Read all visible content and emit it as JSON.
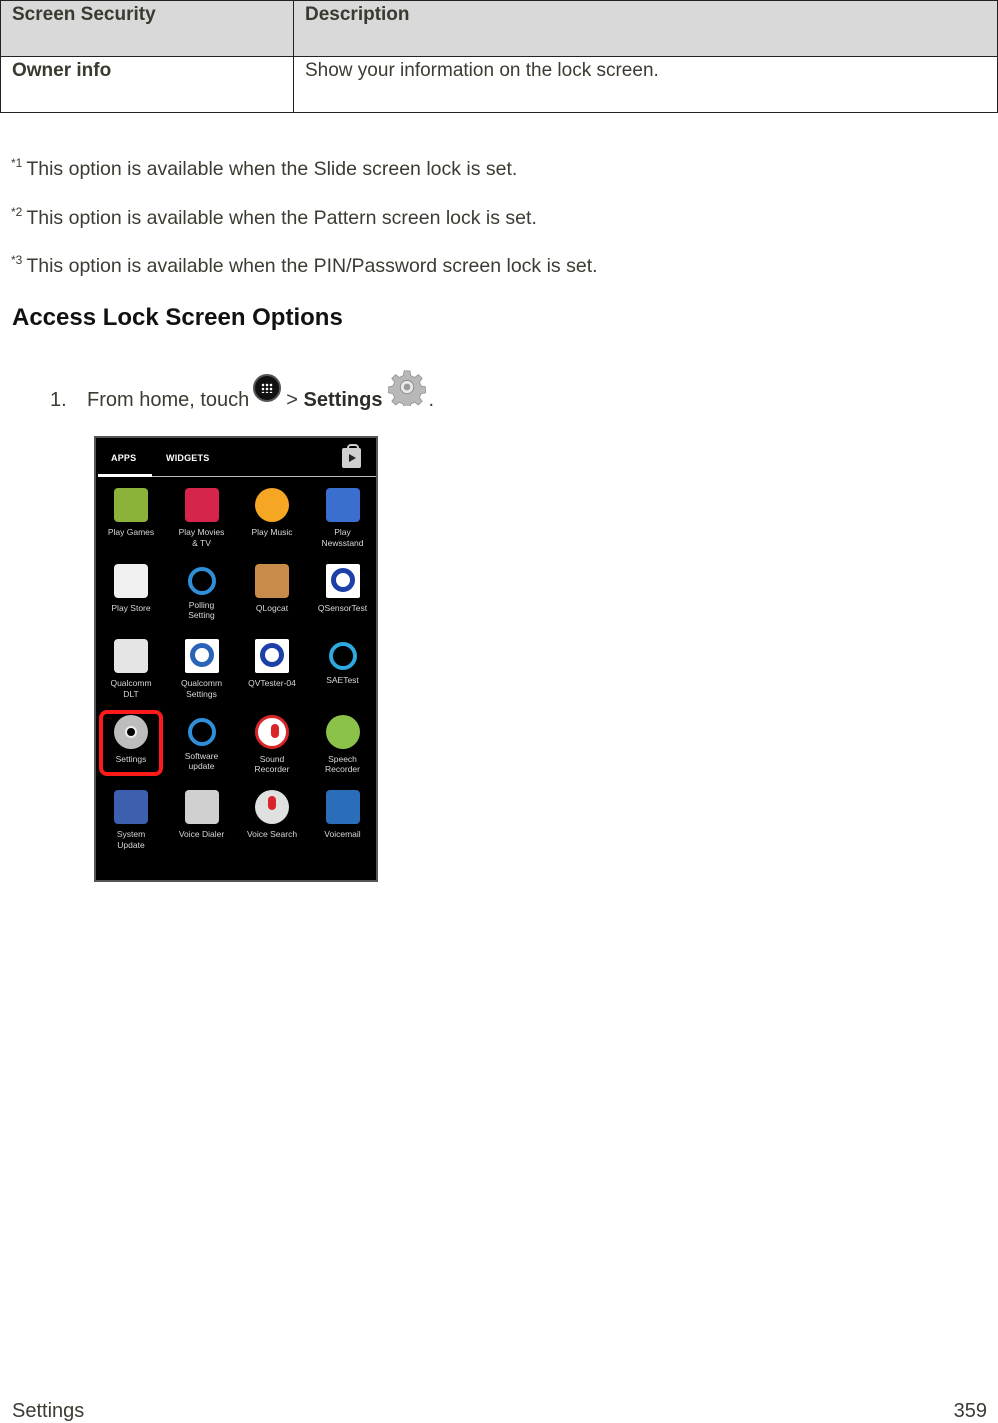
{
  "table": {
    "headers": [
      "Screen Security",
      "Description"
    ],
    "rows": [
      {
        "option": "Owner info",
        "description": "Show your information on the lock screen."
      }
    ]
  },
  "notes": [
    {
      "marker": "*1",
      "text": "This option is available when the Slide screen lock is set."
    },
    {
      "marker": "*2",
      "text": "This option is available when the Pattern screen lock is set."
    },
    {
      "marker": "*3",
      "text": "This option is available when the PIN/Password screen lock is set."
    }
  ],
  "section": {
    "title": "Access Lock Screen Options",
    "steps": [
      {
        "number": "1.",
        "text_before": "From home, touch",
        "icon1": "apps-icon",
        "separator": ">",
        "bold": "Settings",
        "icon2": "settings-gear-icon",
        "text_after": "."
      }
    ]
  },
  "phone_screenshot": {
    "tabs": [
      "APPS",
      "WIDGETS"
    ],
    "active_tab": "APPS",
    "store_icon": "play-store-bag-icon",
    "highlight_color": "#ff1a1a",
    "highlighted_app": "Settings",
    "apps": [
      {
        "label": "Play Games",
        "icon": "gamepad-icon",
        "color": "#8bb23a"
      },
      {
        "label": "Play Movies\n& TV",
        "icon": "film-icon",
        "color": "#d6244a"
      },
      {
        "label": "Play Music",
        "icon": "headphones-icon",
        "color": "#f5a623"
      },
      {
        "label": "Play\nNewsstand",
        "icon": "newspaper-icon",
        "color": "#3a6fd0"
      },
      {
        "label": "Play Store",
        "icon": "shopping-bag-icon",
        "color": "#f1f1f1"
      },
      {
        "label": "Polling\nSetting",
        "icon": "sync-arrows-icon",
        "color": "#2f8fd8"
      },
      {
        "label": "QLogcat",
        "icon": "clipboard-icon",
        "color": "#c98b4a"
      },
      {
        "label": "QSensorTest",
        "icon": "qualcomm-q-icon",
        "color": "#1d3fa8"
      },
      {
        "label": "Qualcomm\nDLT",
        "icon": "pushpin-dlt-icon",
        "color": "#e5e5e5"
      },
      {
        "label": "Qualcomm\nSettings",
        "icon": "qualcomm-q-icon",
        "color": "#2a63b8"
      },
      {
        "label": "QVTester-04",
        "icon": "qualcomm-q-icon",
        "color": "#1d3fa8"
      },
      {
        "label": "SAETest",
        "icon": "magnifier-icon",
        "color": "#2ea8e0"
      },
      {
        "label": "Settings",
        "icon": "gear-icon",
        "color": "#bdbdbd"
      },
      {
        "label": "Software\nupdate",
        "icon": "sync-arrows-icon",
        "color": "#2f8fd8"
      },
      {
        "label": "Sound\nRecorder",
        "icon": "microphone-icon",
        "color": "#d9252a"
      },
      {
        "label": "Speech\nRecorder",
        "icon": "android-robot-icon",
        "color": "#8bc34a"
      },
      {
        "label": "System\nUpdate",
        "icon": "tools-icon",
        "color": "#3d5fb0"
      },
      {
        "label": "Voice Dialer",
        "icon": "speaker-grille-icon",
        "color": "#d0d0d0"
      },
      {
        "label": "Voice Search",
        "icon": "microphone-icon",
        "color": "#e0e0e0"
      },
      {
        "label": "Voicemail",
        "icon": "voicemail-icon",
        "color": "#2a6db8"
      }
    ]
  },
  "footer": {
    "section": "Settings",
    "page": "359"
  }
}
